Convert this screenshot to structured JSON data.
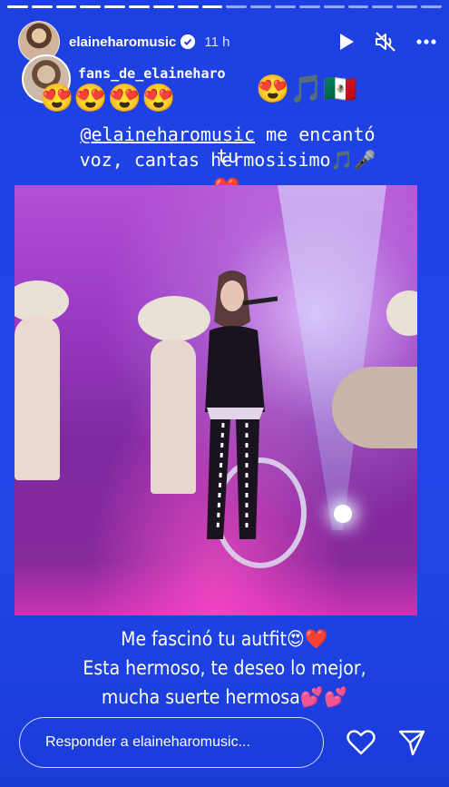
{
  "progress": {
    "segments": 18,
    "completed": 9
  },
  "header": {
    "username": "elaineharomusic",
    "time": "11 h",
    "icons": [
      "play-icon",
      "muted-icon",
      "more-icon"
    ]
  },
  "repost": {
    "fan_username": "fans_de_elaineharo",
    "emojis_left": "😍😍😍😍",
    "emojis_right": "😍🎵🇲🇽"
  },
  "caption_top": {
    "mention": "@elaineharomusic",
    "line1_rest": "me encantó tu",
    "line2": "voz, cantas hermosisimo🎵🎤",
    "line3": "❤️"
  },
  "caption_bottom": {
    "line1": "Me fascinó tu autfit😍❤️",
    "line2": "Esta hermoso, te deseo lo mejor,",
    "line3": "mucha suerte hermosa💕💕"
  },
  "reply": {
    "placeholder": "Responder a elaineharomusic..."
  },
  "colors": {
    "background": "#1f44e8",
    "text": "#ffffff",
    "stage": "#9a3ac4"
  }
}
